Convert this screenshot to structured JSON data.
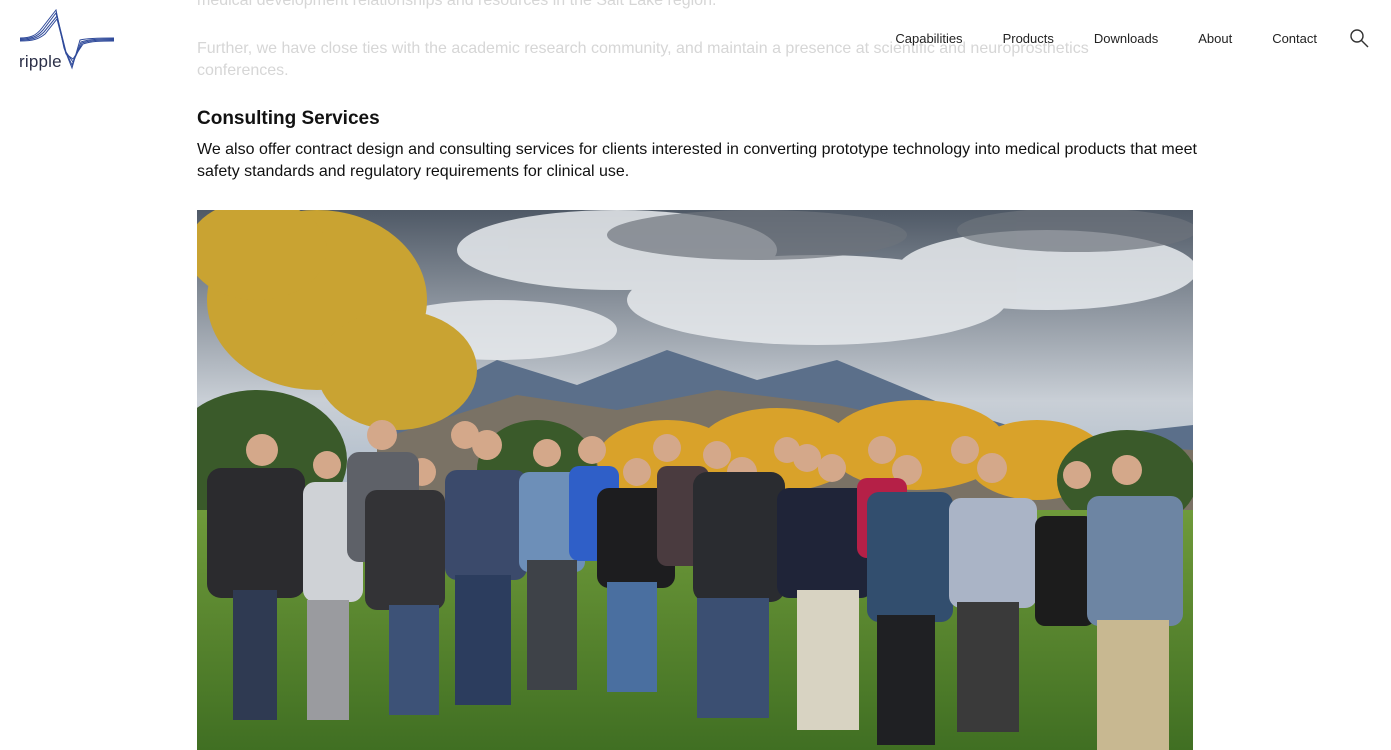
{
  "intro": {
    "line_partial": "medical development relationships and resources in the Salt Lake region.",
    "paragraph": "Further, we have close ties with the academic research community, and maintain a presence at scientific and neuroprosthetics conferences."
  },
  "brand": {
    "name": "ripple"
  },
  "nav": {
    "items": [
      "Capabilities",
      "Products",
      "Downloads",
      "About",
      "Contact"
    ]
  },
  "section": {
    "heading": "Consulting Services",
    "body": "We also offer contract design and consulting services for clients interested in converting prototype technology into medical products that meet safety standards and regulatory requirements for clinical use."
  },
  "colors": {
    "brand_blue": "#2f4a9a",
    "text": "#111111",
    "faded_text": "#d6d6d6"
  }
}
